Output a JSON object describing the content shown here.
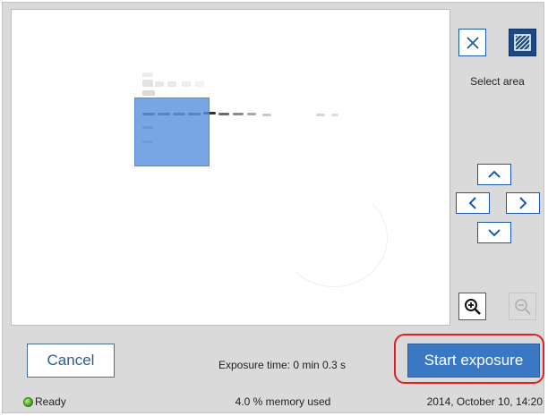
{
  "toolbar": {
    "close_icon": "close-icon",
    "select_area_icon": "hatched-square-icon",
    "select_area_label": "Select area"
  },
  "navigation": {
    "up_icon": "chevron-up-icon",
    "left_icon": "chevron-left-icon",
    "right_icon": "chevron-right-icon",
    "down_icon": "chevron-down-icon"
  },
  "zoom": {
    "in_icon": "zoom-in-icon",
    "out_icon": "zoom-out-icon",
    "out_enabled": false
  },
  "actions": {
    "cancel_label": "Cancel",
    "start_label": "Start exposure",
    "start_highlighted": true
  },
  "exposure": {
    "text": "Exposure time: 0 min 0.3 s"
  },
  "status": {
    "state": "Ready",
    "memory": "4.0 % memory used",
    "datetime": "2014, October 10, 14:20"
  },
  "colors": {
    "accent": "#3a78c3",
    "selection": "#568fdc",
    "highlight_ring": "#e02020",
    "status_ok": "#3f9a1d"
  }
}
